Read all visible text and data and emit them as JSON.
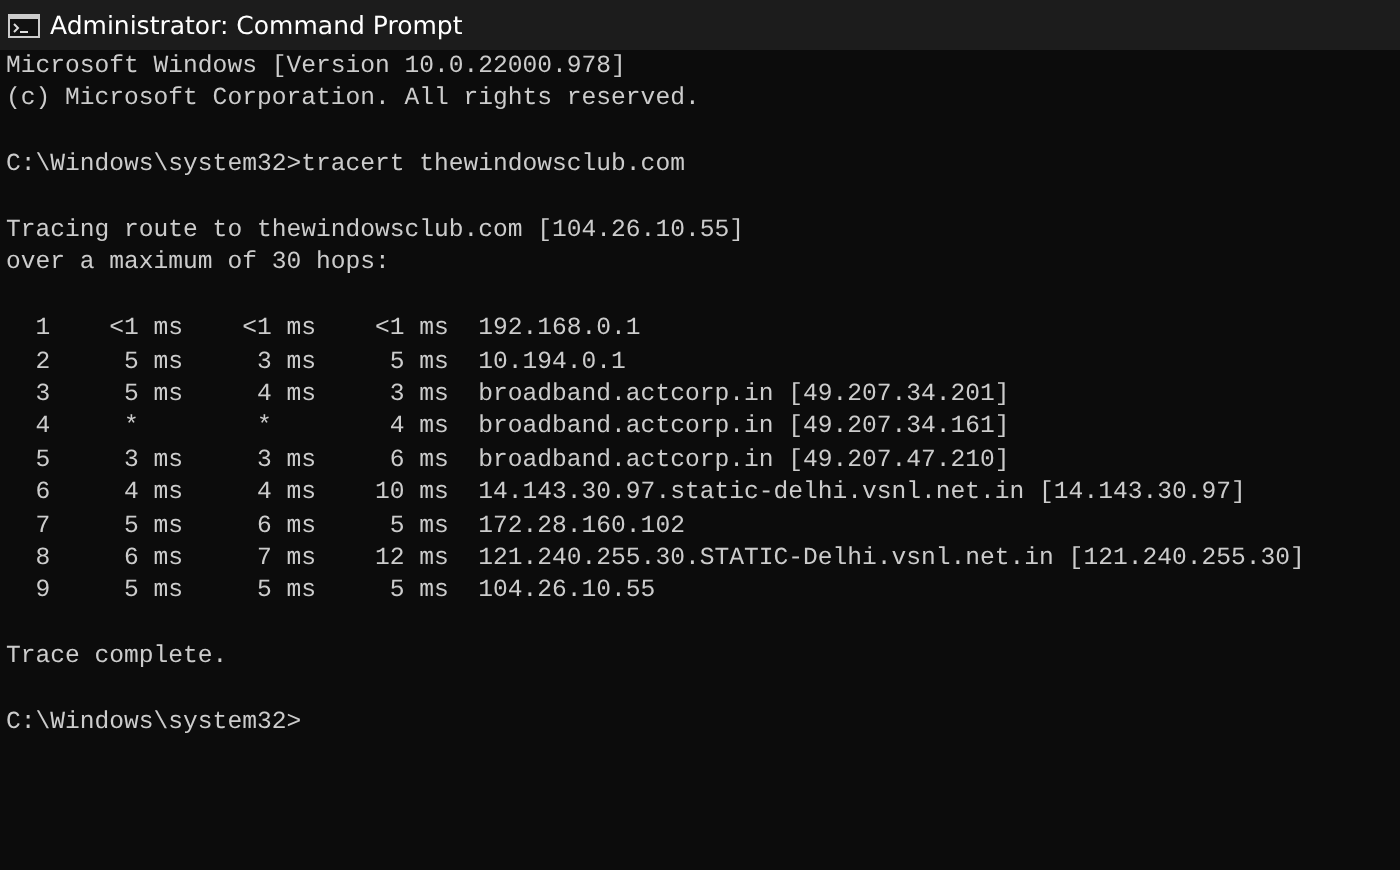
{
  "window": {
    "title": "Administrator: Command Prompt"
  },
  "console": {
    "blocks": [
      {
        "lines": [
          "Microsoft Windows [Version 10.0.22000.978]",
          "(c) Microsoft Corporation. All rights reserved."
        ]
      },
      {
        "lines": [
          "C:\\Windows\\system32>tracert thewindowsclub.com"
        ]
      },
      {
        "lines": [
          "Tracing route to thewindowsclub.com [104.26.10.55]",
          "over a maximum of 30 hops:"
        ]
      },
      {
        "lines": [
          "  1    <1 ms    <1 ms    <1 ms  192.168.0.1",
          "  2     5 ms     3 ms     5 ms  10.194.0.1",
          "  3     5 ms     4 ms     3 ms  broadband.actcorp.in [49.207.34.201]",
          "  4     *        *        4 ms  broadband.actcorp.in [49.207.34.161]",
          "  5     3 ms     3 ms     6 ms  broadband.actcorp.in [49.207.47.210]",
          "  6     4 ms     4 ms    10 ms  14.143.30.97.static-delhi.vsnl.net.in [14.143.30.97]",
          "  7     5 ms     6 ms     5 ms  172.28.160.102",
          "  8     6 ms     7 ms    12 ms  121.240.255.30.STATIC-Delhi.vsnl.net.in [121.240.255.30]",
          "  9     5 ms     5 ms     5 ms  104.26.10.55"
        ]
      },
      {
        "lines": [
          "Trace complete."
        ]
      },
      {
        "lines": [
          "C:\\Windows\\system32>"
        ]
      }
    ]
  }
}
